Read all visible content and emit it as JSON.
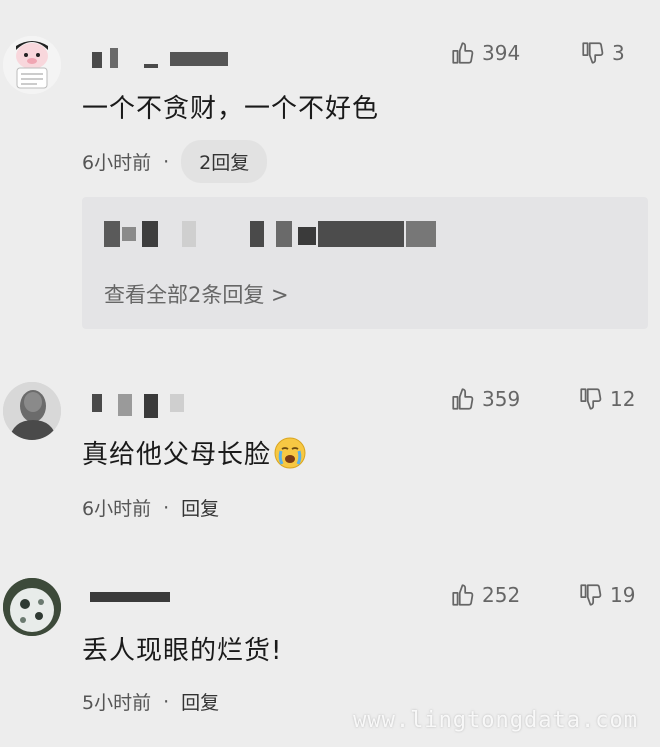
{
  "comments": [
    {
      "content": "一个不贪财，一个不好色",
      "time": "6小时前",
      "dot": "·",
      "reply_label": "2回复",
      "likes": "394",
      "dislikes": "3",
      "replies_preview": {
        "view_all": "查看全部2条回复 >"
      }
    },
    {
      "content": "真给他父母长脸",
      "emoji_icon": "crying-face-icon",
      "time": "6小时前",
      "dot": "·",
      "reply_label": "回复",
      "likes": "359",
      "dislikes": "12"
    },
    {
      "content": "丢人现眼的烂货!",
      "time": "5小时前",
      "dot": "·",
      "reply_label": "回复",
      "likes": "252",
      "dislikes": "19"
    }
  ],
  "watermark": "www.lingtongdata.com",
  "icons": {
    "like": "thumbs-up-icon",
    "dislike": "thumbs-down-icon"
  },
  "colors": {
    "background": "#ededed",
    "text": "#1a1a1a",
    "secondary": "#555555",
    "reply_box": "#e4e4e6"
  }
}
